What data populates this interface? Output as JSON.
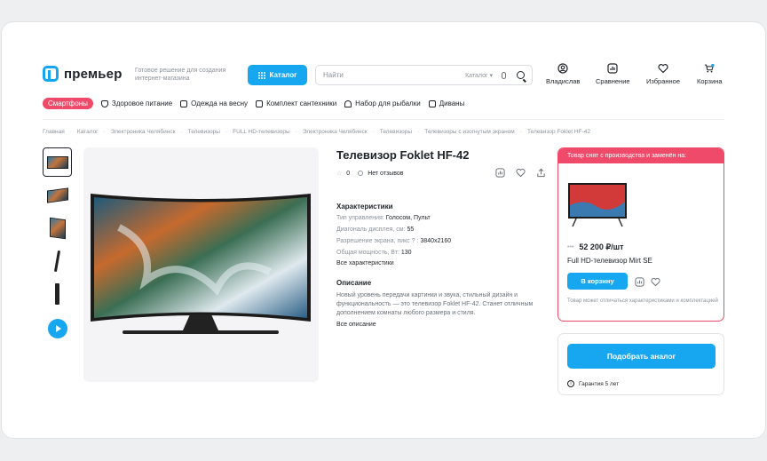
{
  "header": {
    "logo_text": "премьер",
    "tagline": "Готовое решение для создания интернет-магазина",
    "catalog_button": "Каталог",
    "search_placeholder": "Найти",
    "search_category": "Каталог",
    "actions": [
      {
        "label": "Владислав",
        "icon": "user-icon"
      },
      {
        "label": "Сравнение",
        "icon": "compare-icon"
      },
      {
        "label": "Избранное",
        "icon": "heart-icon"
      },
      {
        "label": "Корзина",
        "icon": "cart-icon"
      }
    ]
  },
  "categories": [
    "Смартфоны",
    "Здоровое питание",
    "Одежда на весну",
    "Комплект сантехники",
    "Набор для рыбалки",
    "Диваны"
  ],
  "breadcrumbs": [
    "Главная",
    "Каталог",
    "Электроника Челябинск",
    "Телевизоры",
    "FULL HD-телевизоры",
    "Электроника Челябинск",
    "Телевизоры",
    "Телевизоры с изогнутым экраном",
    "Телевизор Foklet HF-42"
  ],
  "product": {
    "title": "Телевизор Foklet HF-42",
    "rating": "0",
    "reviews": "Нет отзывов",
    "characteristics_title": "Характеристики",
    "characteristics": [
      {
        "label": "Тип управления:",
        "value": "Голосом, Пульт"
      },
      {
        "label": "Диагональ дисплея, см:",
        "value": "55"
      },
      {
        "label": "Разрешение экрана, пикс ? :",
        "value": "3840x2160"
      },
      {
        "label": "Общая мощность, Вт:",
        "value": "130"
      }
    ],
    "all_characteristics": "Все характеристики",
    "description_title": "Описание",
    "description": "Новый уровень передачи картинки и звука, стильный дизайн и функциональность — это телевизор Foklet HF-42. Станет отличным дополнением комнаты любого размера и стиля.",
    "all_description": "Все описание"
  },
  "replacement": {
    "header": "Товар снят с производства и заменён на:",
    "price": "52 200 ₽/шт",
    "name": "Full HD-телевизор Mirt SE",
    "cart_button": "В корзину",
    "note": "Товар может отличаться характеристиками и комплектацией"
  },
  "analog_button": "Подобрать аналог",
  "warranty": "Гарантия 5 лет",
  "colors": {
    "accent": "#17a7f0",
    "alert": "#ef4a6a"
  }
}
